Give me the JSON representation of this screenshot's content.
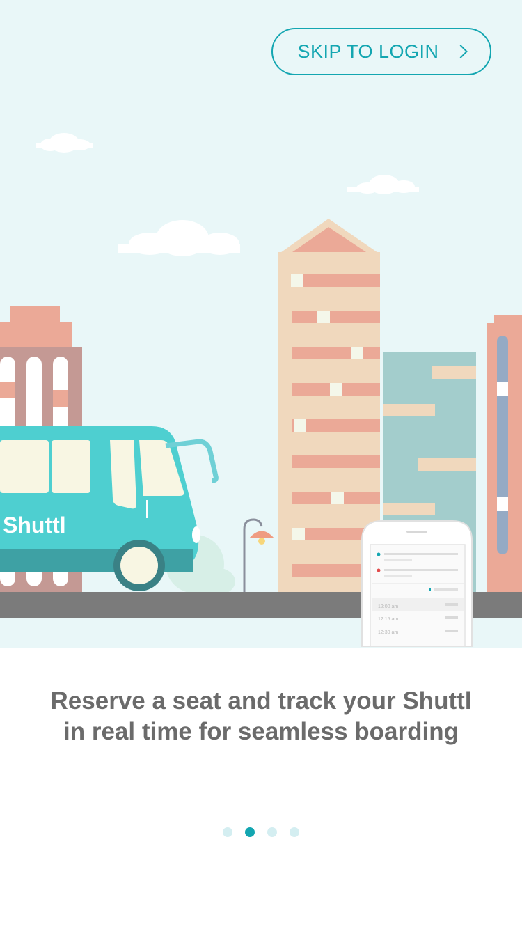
{
  "skip_button": {
    "label": "SKIP TO LOGIN"
  },
  "illustration": {
    "bus_brand": "Shuttl",
    "phone_times": [
      "12:00 am",
      "12:15 am",
      "12:30 am"
    ]
  },
  "caption": {
    "line1": "Reserve a seat and track your Shuttl",
    "line2": "in real time for seamless boarding"
  },
  "pagination": {
    "total": 4,
    "active_index": 1
  },
  "colors": {
    "accent": "#13a6b1",
    "sky": "#e9f7f8",
    "bus": "#4ecfd0",
    "building_beige": "#f0d8bd",
    "building_pink": "#eba997",
    "road": "#7b7b7b",
    "caption_text": "#6b6b6b"
  }
}
